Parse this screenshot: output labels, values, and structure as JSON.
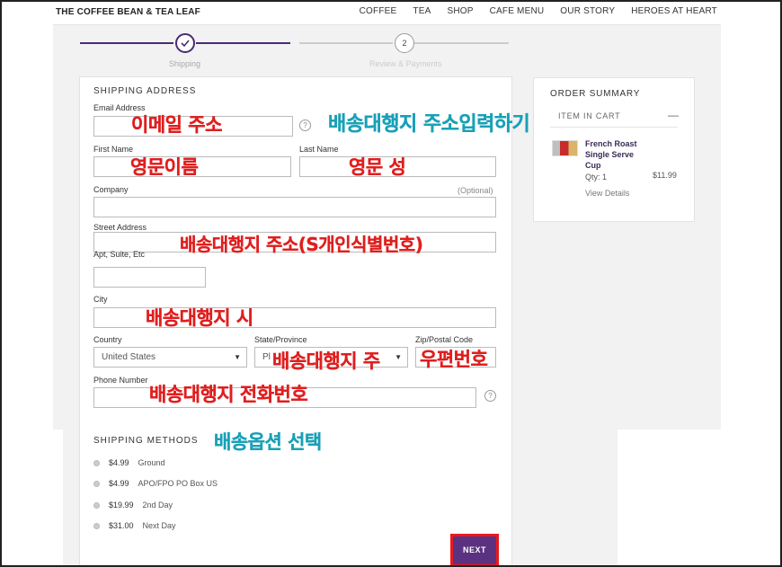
{
  "header": {
    "logo": "THE COFFEE BEAN & TEA LEAF",
    "nav": [
      "COFFEE",
      "TEA",
      "SHOP",
      "CAFE MENU",
      "OUR STORY",
      "HEROES AT HEART"
    ]
  },
  "progress": {
    "steps": [
      {
        "label": "Shipping",
        "icon": "check-icon",
        "active": true
      },
      {
        "label": "Review & Payments",
        "number": "2",
        "active": false
      }
    ]
  },
  "form": {
    "title": "SHIPPING ADDRESS",
    "email_label": "Email Address",
    "first_name_label": "First Name",
    "last_name_label": "Last Name",
    "company_label": "Company",
    "optional": "(Optional)",
    "street_label": "Street Address",
    "apt_label": "Apt, Suite, Etc",
    "city_label": "City",
    "country_label": "Country",
    "country_value": "United States",
    "state_label": "State/Province",
    "state_value": "Pl",
    "zip_label": "Zip/Postal Code",
    "phone_label": "Phone Number",
    "help": "?"
  },
  "shipping_methods": {
    "title": "SHIPPING METHODS",
    "options": [
      {
        "price": "$4.99",
        "name": "Ground"
      },
      {
        "price": "$4.99",
        "name": "APO/FPO PO Box US"
      },
      {
        "price": "$19.99",
        "name": "2nd Day"
      },
      {
        "price": "$31.00",
        "name": "Next Day"
      }
    ],
    "next_label": "NEXT"
  },
  "summary": {
    "title": "ORDER SUMMARY",
    "items_header": "ITEM IN CART",
    "collapse": "—",
    "product": {
      "name": "French Roast Single Serve Cup",
      "qty": "Qty: 1",
      "price": "$11.99",
      "link": "View Details"
    }
  },
  "annotations": {
    "email": "이메일 주소",
    "address_input": "배송대행지 주소입력하기",
    "first_name": "영문이름",
    "last_name": "영문 성",
    "street": "배송대행지 주소(S개인식별번호)",
    "city": "배송대행지 시",
    "state": "배송대행지 주",
    "zip": "우편번호",
    "phone": "배송대행지 전화번호",
    "shipping_option": "배송옵션 선택"
  },
  "colors": {
    "brand_purple": "#5b3281",
    "annotation_red": "#e01f1f",
    "annotation_blue": "#1aa0b7",
    "highlight_border": "#e8191c"
  }
}
